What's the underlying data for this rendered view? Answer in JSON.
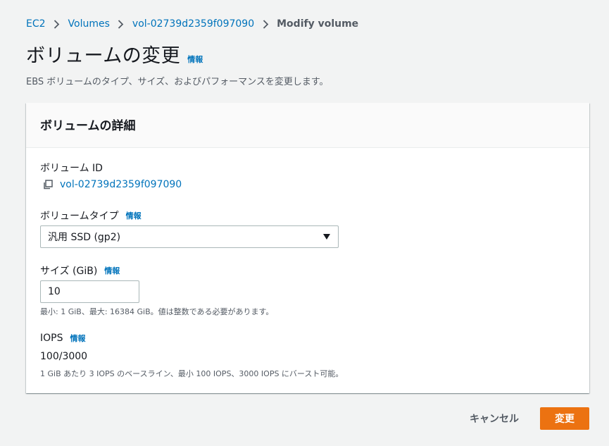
{
  "breadcrumb": {
    "items": [
      "EC2",
      "Volumes",
      "vol-02739d2359f097090"
    ],
    "current": "Modify volume"
  },
  "header": {
    "title": "ボリュームの変更",
    "info": "情報",
    "description": "EBS ボリュームのタイプ、サイズ、およびパフォーマンスを変更します。"
  },
  "panel": {
    "title": "ボリュームの詳細",
    "volume_id": {
      "label": "ボリューム ID",
      "value": "vol-02739d2359f097090"
    },
    "volume_type": {
      "label": "ボリュームタイプ",
      "info": "情報",
      "selected": "汎用 SSD (gp2)"
    },
    "size": {
      "label": "サイズ (GiB)",
      "info": "情報",
      "value": "10",
      "hint": "最小: 1 GiB、最大: 16384 GiB。値は整数である必要があります。"
    },
    "iops": {
      "label": "IOPS",
      "info": "情報",
      "value": "100/3000",
      "hint": "1 GiB あたり 3 IOPS のベースライン、最小 100 IOPS、3000 IOPS にバースト可能。"
    }
  },
  "actions": {
    "cancel": "キャンセル",
    "submit": "変更"
  },
  "colors": {
    "link": "#0073bb",
    "primary": "#ec7211",
    "background": "#f2f3f3"
  },
  "icons": [
    "chevron-right-icon",
    "copy-icon",
    "caret-down-icon"
  ]
}
